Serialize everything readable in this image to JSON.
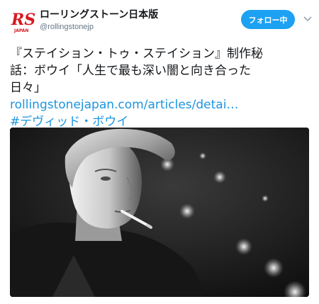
{
  "account": {
    "display_name": "ローリングストーン日本版",
    "handle": "@rollingstonejp",
    "logo_text": "RS",
    "logo_subtext": "JAPAN"
  },
  "follow_button": {
    "label": "フォロー中"
  },
  "tweet": {
    "lines": [
      "『ステイション・トゥ・ステイション』制作秘",
      "話：ボウイ「人生で最も深い闇と向き合った",
      "日々」"
    ],
    "link": "rollingstonejapan.com/articles/detai…",
    "hashtag": "#デヴィッド・ボウイ"
  },
  "media": {
    "kind": "black-and-white-photo"
  },
  "colors": {
    "accent": "#1da1f2",
    "link": "#1b95e0",
    "logo_red": "#d71920",
    "text": "#14171a",
    "muted": "#657786"
  }
}
